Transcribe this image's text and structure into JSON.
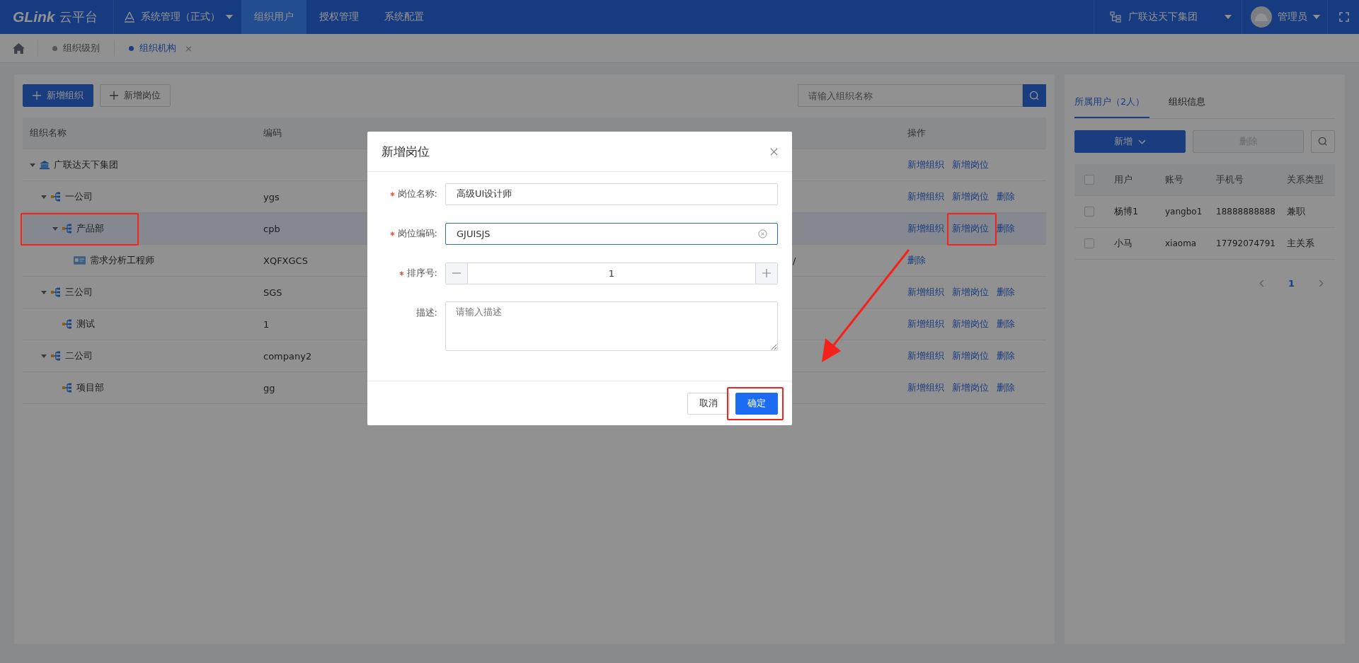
{
  "topbar": {
    "logo": "GLink",
    "logo_suffix": "云平台",
    "app_switcher": "系统管理（正式）",
    "nav": [
      {
        "label": "组织用户",
        "selected": true
      },
      {
        "label": "授权管理",
        "selected": false
      },
      {
        "label": "系统配置",
        "selected": false
      }
    ],
    "org": "广联达天下集团",
    "user": "管理员"
  },
  "breadcrumb_tabs": [
    {
      "label": "组织级别",
      "selected": false,
      "closable": false
    },
    {
      "label": "组织机构",
      "selected": true,
      "closable": true
    }
  ],
  "close_mark": "×",
  "toolbar": {
    "buttons": [
      {
        "label": "新增组织",
        "primary": true
      },
      {
        "label": "新增岗位",
        "primary": false
      }
    ],
    "search": {
      "placeholder": "请输入组织名称"
    }
  },
  "org_table": {
    "columns": [
      "组织名称",
      "编码",
      "操作"
    ],
    "rows": [
      {
        "name": "广联达天下集团",
        "kind": "group",
        "code": "",
        "expanded": true,
        "selected": false,
        "actions": [
          "新增组织",
          "新增岗位"
        ],
        "children": [
          {
            "name": "一公司",
            "kind": "company",
            "code": "ygs",
            "expanded": true,
            "selected": false,
            "actions": [
              "新增组织",
              "新增岗位",
              "删除"
            ],
            "children": [
              {
                "name": "产品部",
                "kind": "company",
                "code": "cpb",
                "expanded": true,
                "selected": true,
                "actions": [
                  "新增组织",
                  "新增岗位",
                  "删除"
                ],
                "children": [
                  {
                    "name": "需求分析工程师",
                    "kind": "post",
                    "code": "XQFXGCS",
                    "column_3": "/",
                    "selected": false,
                    "actions": [
                      "删除"
                    ]
                  }
                ]
              }
            ]
          },
          {
            "name": "三公司",
            "kind": "company",
            "code": "SGS",
            "expanded": true,
            "selected": false,
            "actions": [
              "新增组织",
              "新增岗位",
              "删除"
            ],
            "children": [
              {
                "name": "测试",
                "kind": "company",
                "code": "1",
                "selected": false,
                "actions": [
                  "新增组织",
                  "新增岗位",
                  "删除"
                ]
              }
            ]
          },
          {
            "name": "二公司",
            "kind": "company",
            "code": "company2",
            "expanded": true,
            "selected": false,
            "actions": [
              "新增组织",
              "新增岗位",
              "删除"
            ],
            "children": [
              {
                "name": "项目部",
                "kind": "company",
                "code": "gg",
                "selected": false,
                "actions": [
                  "新增组织",
                  "新增岗位",
                  "删除"
                ]
              }
            ]
          }
        ]
      }
    ]
  },
  "side_panel": {
    "tabs": [
      {
        "label": "所属用户（2人）",
        "selected": true
      },
      {
        "label": "组织信息",
        "selected": false
      }
    ],
    "add_button": "新增",
    "delete_button": {
      "label": "删除",
      "disabled": true
    },
    "columns": [
      "用户",
      "账号",
      "手机号",
      "关系类型"
    ],
    "all_checked": false,
    "rows": [
      {
        "checked": false,
        "cells": [
          "杨博1",
          "yangbo1",
          "18888888888",
          "兼职"
        ]
      },
      {
        "checked": false,
        "cells": [
          "小马",
          "xiaoma",
          "17792074791",
          "主关系"
        ]
      }
    ],
    "pagination": {
      "pages": [
        {
          "label": "1",
          "selected": true
        }
      ]
    }
  },
  "dialog": {
    "title": "新增岗位",
    "fields": [
      {
        "kind": "text",
        "label": "岗位名称:",
        "required": true,
        "value": "高级UI设计师",
        "focused": false
      },
      {
        "kind": "text",
        "label": "岗位编码:",
        "required": true,
        "value": "GJUISJS",
        "focused": true
      },
      {
        "kind": "number",
        "label": "排序号:",
        "required": true,
        "value": "1",
        "focused": false
      },
      {
        "kind": "textarea",
        "label": "描述:",
        "required": false,
        "placeholder": "请输入描述",
        "focused": false
      }
    ],
    "buttons": [
      {
        "label": "取消",
        "primary": false
      },
      {
        "label": "确定",
        "primary": true
      }
    ]
  },
  "annotations": [
    {
      "kind": "frame"
    },
    {
      "kind": "frame"
    },
    {
      "kind": "frame"
    },
    {
      "kind": "arrow"
    }
  ]
}
